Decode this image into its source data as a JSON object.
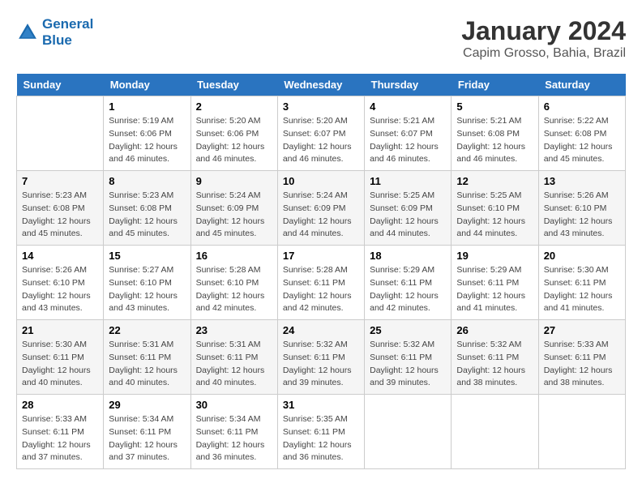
{
  "header": {
    "logo_line1": "General",
    "logo_line2": "Blue",
    "month_year": "January 2024",
    "location": "Capim Grosso, Bahia, Brazil"
  },
  "days_of_week": [
    "Sunday",
    "Monday",
    "Tuesday",
    "Wednesday",
    "Thursday",
    "Friday",
    "Saturday"
  ],
  "weeks": [
    [
      {
        "day": "",
        "info": ""
      },
      {
        "day": "1",
        "info": "Sunrise: 5:19 AM\nSunset: 6:06 PM\nDaylight: 12 hours\nand 46 minutes."
      },
      {
        "day": "2",
        "info": "Sunrise: 5:20 AM\nSunset: 6:06 PM\nDaylight: 12 hours\nand 46 minutes."
      },
      {
        "day": "3",
        "info": "Sunrise: 5:20 AM\nSunset: 6:07 PM\nDaylight: 12 hours\nand 46 minutes."
      },
      {
        "day": "4",
        "info": "Sunrise: 5:21 AM\nSunset: 6:07 PM\nDaylight: 12 hours\nand 46 minutes."
      },
      {
        "day": "5",
        "info": "Sunrise: 5:21 AM\nSunset: 6:08 PM\nDaylight: 12 hours\nand 46 minutes."
      },
      {
        "day": "6",
        "info": "Sunrise: 5:22 AM\nSunset: 6:08 PM\nDaylight: 12 hours\nand 45 minutes."
      }
    ],
    [
      {
        "day": "7",
        "info": "Sunrise: 5:23 AM\nSunset: 6:08 PM\nDaylight: 12 hours\nand 45 minutes."
      },
      {
        "day": "8",
        "info": "Sunrise: 5:23 AM\nSunset: 6:08 PM\nDaylight: 12 hours\nand 45 minutes."
      },
      {
        "day": "9",
        "info": "Sunrise: 5:24 AM\nSunset: 6:09 PM\nDaylight: 12 hours\nand 45 minutes."
      },
      {
        "day": "10",
        "info": "Sunrise: 5:24 AM\nSunset: 6:09 PM\nDaylight: 12 hours\nand 44 minutes."
      },
      {
        "day": "11",
        "info": "Sunrise: 5:25 AM\nSunset: 6:09 PM\nDaylight: 12 hours\nand 44 minutes."
      },
      {
        "day": "12",
        "info": "Sunrise: 5:25 AM\nSunset: 6:10 PM\nDaylight: 12 hours\nand 44 minutes."
      },
      {
        "day": "13",
        "info": "Sunrise: 5:26 AM\nSunset: 6:10 PM\nDaylight: 12 hours\nand 43 minutes."
      }
    ],
    [
      {
        "day": "14",
        "info": "Sunrise: 5:26 AM\nSunset: 6:10 PM\nDaylight: 12 hours\nand 43 minutes."
      },
      {
        "day": "15",
        "info": "Sunrise: 5:27 AM\nSunset: 6:10 PM\nDaylight: 12 hours\nand 43 minutes."
      },
      {
        "day": "16",
        "info": "Sunrise: 5:28 AM\nSunset: 6:10 PM\nDaylight: 12 hours\nand 42 minutes."
      },
      {
        "day": "17",
        "info": "Sunrise: 5:28 AM\nSunset: 6:11 PM\nDaylight: 12 hours\nand 42 minutes."
      },
      {
        "day": "18",
        "info": "Sunrise: 5:29 AM\nSunset: 6:11 PM\nDaylight: 12 hours\nand 42 minutes."
      },
      {
        "day": "19",
        "info": "Sunrise: 5:29 AM\nSunset: 6:11 PM\nDaylight: 12 hours\nand 41 minutes."
      },
      {
        "day": "20",
        "info": "Sunrise: 5:30 AM\nSunset: 6:11 PM\nDaylight: 12 hours\nand 41 minutes."
      }
    ],
    [
      {
        "day": "21",
        "info": "Sunrise: 5:30 AM\nSunset: 6:11 PM\nDaylight: 12 hours\nand 40 minutes."
      },
      {
        "day": "22",
        "info": "Sunrise: 5:31 AM\nSunset: 6:11 PM\nDaylight: 12 hours\nand 40 minutes."
      },
      {
        "day": "23",
        "info": "Sunrise: 5:31 AM\nSunset: 6:11 PM\nDaylight: 12 hours\nand 40 minutes."
      },
      {
        "day": "24",
        "info": "Sunrise: 5:32 AM\nSunset: 6:11 PM\nDaylight: 12 hours\nand 39 minutes."
      },
      {
        "day": "25",
        "info": "Sunrise: 5:32 AM\nSunset: 6:11 PM\nDaylight: 12 hours\nand 39 minutes."
      },
      {
        "day": "26",
        "info": "Sunrise: 5:32 AM\nSunset: 6:11 PM\nDaylight: 12 hours\nand 38 minutes."
      },
      {
        "day": "27",
        "info": "Sunrise: 5:33 AM\nSunset: 6:11 PM\nDaylight: 12 hours\nand 38 minutes."
      }
    ],
    [
      {
        "day": "28",
        "info": "Sunrise: 5:33 AM\nSunset: 6:11 PM\nDaylight: 12 hours\nand 37 minutes."
      },
      {
        "day": "29",
        "info": "Sunrise: 5:34 AM\nSunset: 6:11 PM\nDaylight: 12 hours\nand 37 minutes."
      },
      {
        "day": "30",
        "info": "Sunrise: 5:34 AM\nSunset: 6:11 PM\nDaylight: 12 hours\nand 36 minutes."
      },
      {
        "day": "31",
        "info": "Sunrise: 5:35 AM\nSunset: 6:11 PM\nDaylight: 12 hours\nand 36 minutes."
      },
      {
        "day": "",
        "info": ""
      },
      {
        "day": "",
        "info": ""
      },
      {
        "day": "",
        "info": ""
      }
    ]
  ]
}
